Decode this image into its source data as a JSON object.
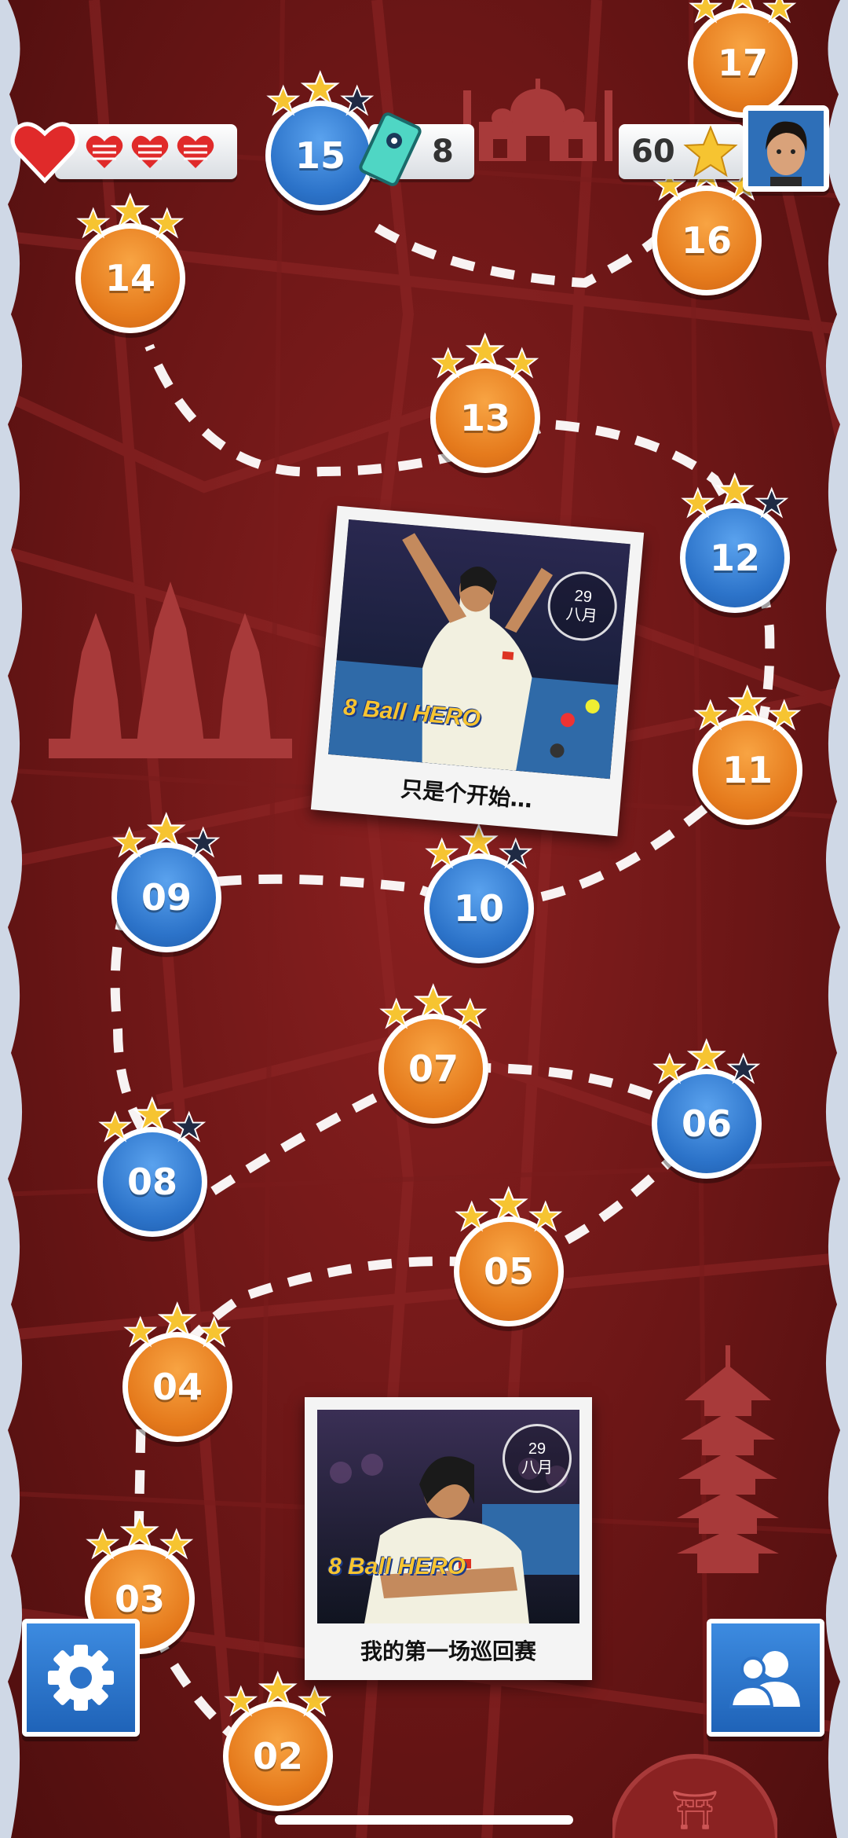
{
  "hud": {
    "lives_full": 1,
    "lives_small": 3,
    "current_level": "15",
    "cue_cards": "8",
    "stars": "60"
  },
  "levels": [
    {
      "num": "02",
      "color": "orange",
      "stars": 3
    },
    {
      "num": "03",
      "color": "orange",
      "stars": 3
    },
    {
      "num": "04",
      "color": "orange",
      "stars": 3
    },
    {
      "num": "05",
      "color": "orange",
      "stars": 3
    },
    {
      "num": "06",
      "color": "blue",
      "stars": 2
    },
    {
      "num": "07",
      "color": "orange",
      "stars": 3
    },
    {
      "num": "08",
      "color": "blue",
      "stars": 2
    },
    {
      "num": "09",
      "color": "blue",
      "stars": 2
    },
    {
      "num": "10",
      "color": "blue",
      "stars": 2
    },
    {
      "num": "11",
      "color": "orange",
      "stars": 3
    },
    {
      "num": "12",
      "color": "blue",
      "stars": 2
    },
    {
      "num": "13",
      "color": "orange",
      "stars": 3
    },
    {
      "num": "14",
      "color": "orange",
      "stars": 3
    },
    {
      "num": "15",
      "color": "blue",
      "stars": 2
    },
    {
      "num": "16",
      "color": "orange",
      "stars": 3
    },
    {
      "num": "17",
      "color": "orange",
      "stars": 3
    }
  ],
  "photo_cards": [
    {
      "day": "29",
      "month": "八月",
      "caption": "只是个开始…",
      "logo": "8 Ball HERO"
    },
    {
      "day": "29",
      "month": "八月",
      "caption": "我的第一场巡回赛",
      "logo": "8 Ball HERO"
    }
  ],
  "buttons": {
    "settings_icon": "gear-icon",
    "friends_icon": "friends-icon"
  },
  "colors": {
    "background": "#6b1616",
    "orange_node": "#e57a1c",
    "blue_node": "#2c73c9",
    "star": "#f6c431",
    "star_empty": "#1f2a44"
  }
}
